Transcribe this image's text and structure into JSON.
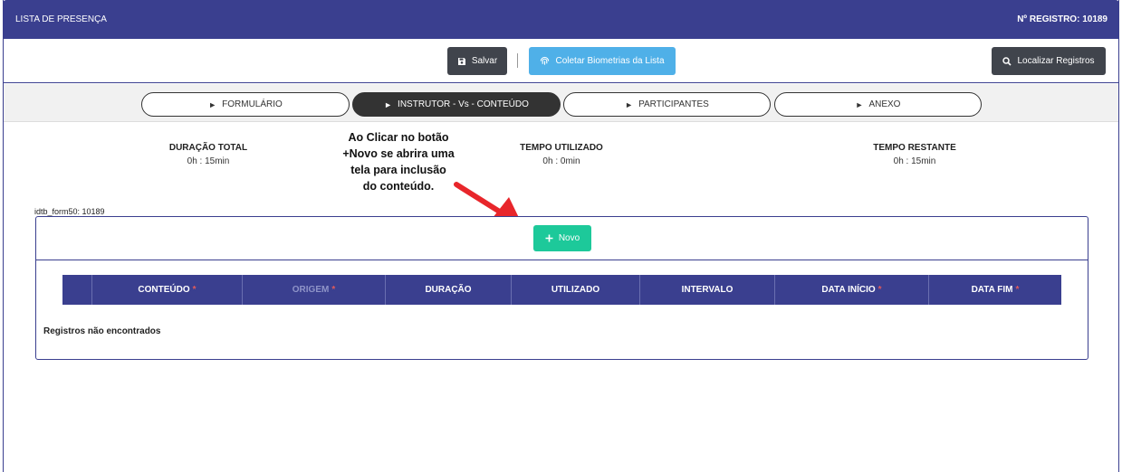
{
  "header": {
    "title": "LISTA DE PRESENÇA",
    "registro": "Nº REGISTRO: 10189"
  },
  "toolbar": {
    "save_label": "Salvar",
    "biometria_label": "Coletar Biometrias da Lista",
    "find_label": "Localizar Registros"
  },
  "tabs": [
    {
      "label": "FORMULÁRIO",
      "active": false
    },
    {
      "label": "INSTRUTOR - Vs - CONTEÚDO",
      "active": true
    },
    {
      "label": "PARTICIPANTES",
      "active": false
    },
    {
      "label": "ANEXO",
      "active": false
    }
  ],
  "stats": {
    "total": {
      "label": "DURAÇÃO TOTAL",
      "value": "0h : 15min"
    },
    "utilizado": {
      "label": "TEMPO UTILIZADO",
      "value": "0h : 0min"
    },
    "restante": {
      "label": "TEMPO RESTANTE",
      "value": "0h : 15min"
    }
  },
  "annotation": "Ao Clicar no botão +Novo se abrira uma tela para inclusão do conteúdo.",
  "id_label": "idtb_form50: 10189",
  "novo_label": "Novo",
  "table": {
    "columns": [
      {
        "label": "CONTEÚDO",
        "required": "*"
      },
      {
        "label": "ORIGEM",
        "required": "*"
      },
      {
        "label": "DURAÇÃO",
        "required": ""
      },
      {
        "label": "UTILIZADO",
        "required": ""
      },
      {
        "label": "INTERVALO",
        "required": ""
      },
      {
        "label": "DATA INÍCIO",
        "required": "*"
      },
      {
        "label": "DATA FIM",
        "required": "*"
      }
    ],
    "empty_message": "Registros não encontrados"
  },
  "colors": {
    "primary": "#3a3f8f",
    "accent_green": "#1dc99a",
    "accent_blue": "#4fb0e8",
    "dark_button": "#40444c",
    "annotation_arrow": "#e8262b"
  },
  "icons": [
    "save-icon",
    "fingerprint-icon",
    "search-icon",
    "chevron-right-icon",
    "plus-icon",
    "red-arrow"
  ]
}
